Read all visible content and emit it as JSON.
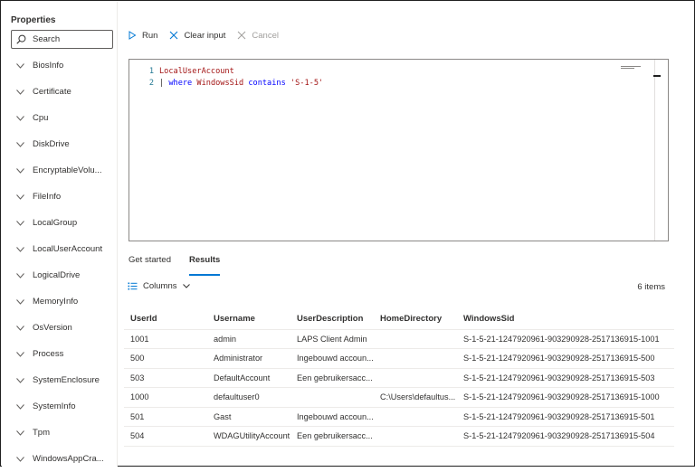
{
  "sidebar": {
    "title": "Properties",
    "search_placeholder": "Search",
    "items": [
      {
        "label": "BiosInfo"
      },
      {
        "label": "Certificate"
      },
      {
        "label": "Cpu"
      },
      {
        "label": "DiskDrive"
      },
      {
        "label": "EncryptableVolu..."
      },
      {
        "label": "FileInfo"
      },
      {
        "label": "LocalGroup"
      },
      {
        "label": "LocalUserAccount"
      },
      {
        "label": "LogicalDrive"
      },
      {
        "label": "MemoryInfo"
      },
      {
        "label": "OsVersion"
      },
      {
        "label": "Process"
      },
      {
        "label": "SystemEnclosure"
      },
      {
        "label": "SystemInfo"
      },
      {
        "label": "Tpm"
      },
      {
        "label": "WindowsAppCra..."
      }
    ]
  },
  "toolbar": {
    "run_label": "Run",
    "clear_label": "Clear input",
    "cancel_label": "Cancel"
  },
  "editor": {
    "line1_no": "1",
    "line1_table": "LocalUserAccount",
    "line2_no": "2",
    "line2_pipe": "| ",
    "line2_op": "where",
    "line2_field": "WindowsSid",
    "line2_op2": "contains",
    "line2_str": "'S-1-5'"
  },
  "tabs": {
    "get_started": "Get started",
    "results": "Results"
  },
  "results": {
    "columns_label": "Columns",
    "count_label": "6 items",
    "headers": [
      "UserId",
      "Username",
      "UserDescription",
      "HomeDirectory",
      "WindowsSid"
    ],
    "rows": [
      [
        "1001",
        "admin",
        "LAPS Client Admin",
        "",
        "S-1-5-21-1247920961-903290928-2517136915-1001"
      ],
      [
        "500",
        "Administrator",
        "Ingebouwd accoun...",
        "",
        "S-1-5-21-1247920961-903290928-2517136915-500"
      ],
      [
        "503",
        "DefaultAccount",
        "Een gebruikersacc...",
        "",
        "S-1-5-21-1247920961-903290928-2517136915-503"
      ],
      [
        "1000",
        "defaultuser0",
        "",
        "C:\\Users\\defaultus...",
        "S-1-5-21-1247920961-903290928-2517136915-1000"
      ],
      [
        "501",
        "Gast",
        "Ingebouwd accoun...",
        "",
        "S-1-5-21-1247920961-903290928-2517136915-501"
      ],
      [
        "504",
        "WDAGUtilityAccount",
        "Een gebruikersacc...",
        "",
        "S-1-5-21-1247920961-903290928-2517136915-504"
      ]
    ]
  },
  "colors": {
    "accent": "#0078d4",
    "keyword": "#0000ff",
    "identifier": "#a31515",
    "line_number": "#237893"
  },
  "icons": {
    "search": "search-icon",
    "chevron": "chevron-down-icon",
    "run": "play-icon",
    "clear": "clear-icon",
    "cancel": "cancel-icon",
    "columns": "columns-icon"
  }
}
